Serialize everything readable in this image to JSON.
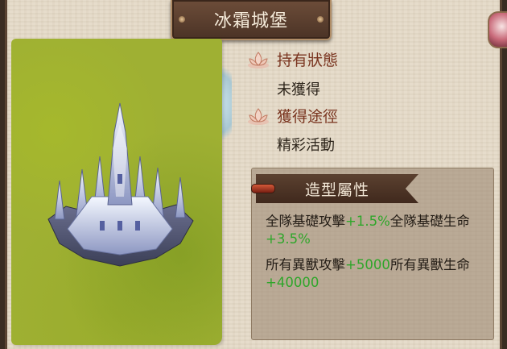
{
  "title": "冰霜城堡",
  "status": {
    "label": "持有狀態",
    "value": "未獲得"
  },
  "source": {
    "label": "獲得途徑",
    "value": "精彩活動"
  },
  "attributes": {
    "header": "造型屬性",
    "lines": [
      {
        "a": "全隊基礎攻擊",
        "a_bonus": "+1.5%",
        "b": "全隊基礎生命",
        "b_bonus": "+3.5%"
      },
      {
        "a": "所有異獸攻擊",
        "a_bonus": "+5000",
        "b": "所有異獸生命",
        "b_bonus": "+40000"
      }
    ]
  },
  "colors": {
    "bonus": "#2fa62a",
    "label": "#7a3520",
    "panel": "#e6dccb"
  },
  "icons": {
    "lotus": "lotus-icon",
    "castle": "ice-castle-image"
  }
}
